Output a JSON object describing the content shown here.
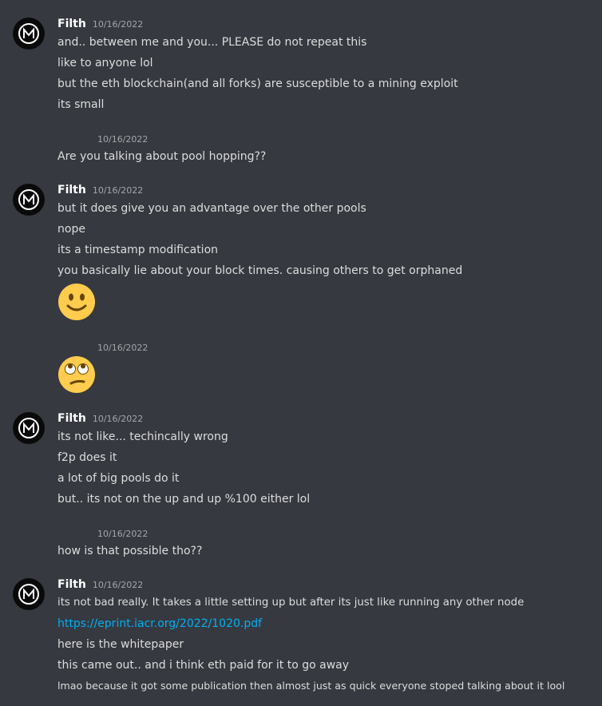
{
  "username": "Filth",
  "colors": {
    "background": "#36393f",
    "text": "#dcddde",
    "timestamp": "#a3a6aa",
    "link": "#00aff4",
    "emoji": "#ffcc4d"
  },
  "groups": [
    {
      "timestamp": "10/16/2022",
      "lines": [
        "and.. between me and you... PLEASE do not repeat this",
        "like to anyone lol",
        "but the eth blockchain(and all forks) are susceptible to a mining exploit",
        "its small"
      ]
    },
    {
      "timestamp": "10/16/2022",
      "lines": [
        "Are you talking about pool hopping??"
      ]
    },
    {
      "timestamp": "10/16/2022",
      "lines": [
        "but it does give you an advantage over the other pools",
        "nope",
        "its a timestamp modification",
        "you basically lie about your block times. causing others to get orphaned"
      ],
      "emoji": "slightly-smiling-face-emoji"
    },
    {
      "timestamp": "10/16/2022",
      "emoji": "rolling-eyes-emoji"
    },
    {
      "timestamp": "10/16/2022",
      "lines": [
        "its not like... techincally wrong",
        "f2p does it",
        "a lot of big pools do it",
        "but.. its not on the up and up %100 either lol"
      ]
    },
    {
      "timestamp": "10/16/2022",
      "lines": [
        "how is that possible tho??"
      ]
    },
    {
      "timestamp": "10/16/2022",
      "lines": [
        "its not bad really. It takes a little setting up but after its just like running any other node",
        "https://eprint.iacr.org/2022/1020.pdf",
        "here is the whitepaper",
        "this came out.. and i think eth paid for it to go away",
        "lmao because it got some publication then almost just as quick everyone stoped talking about it lool"
      ]
    }
  ]
}
